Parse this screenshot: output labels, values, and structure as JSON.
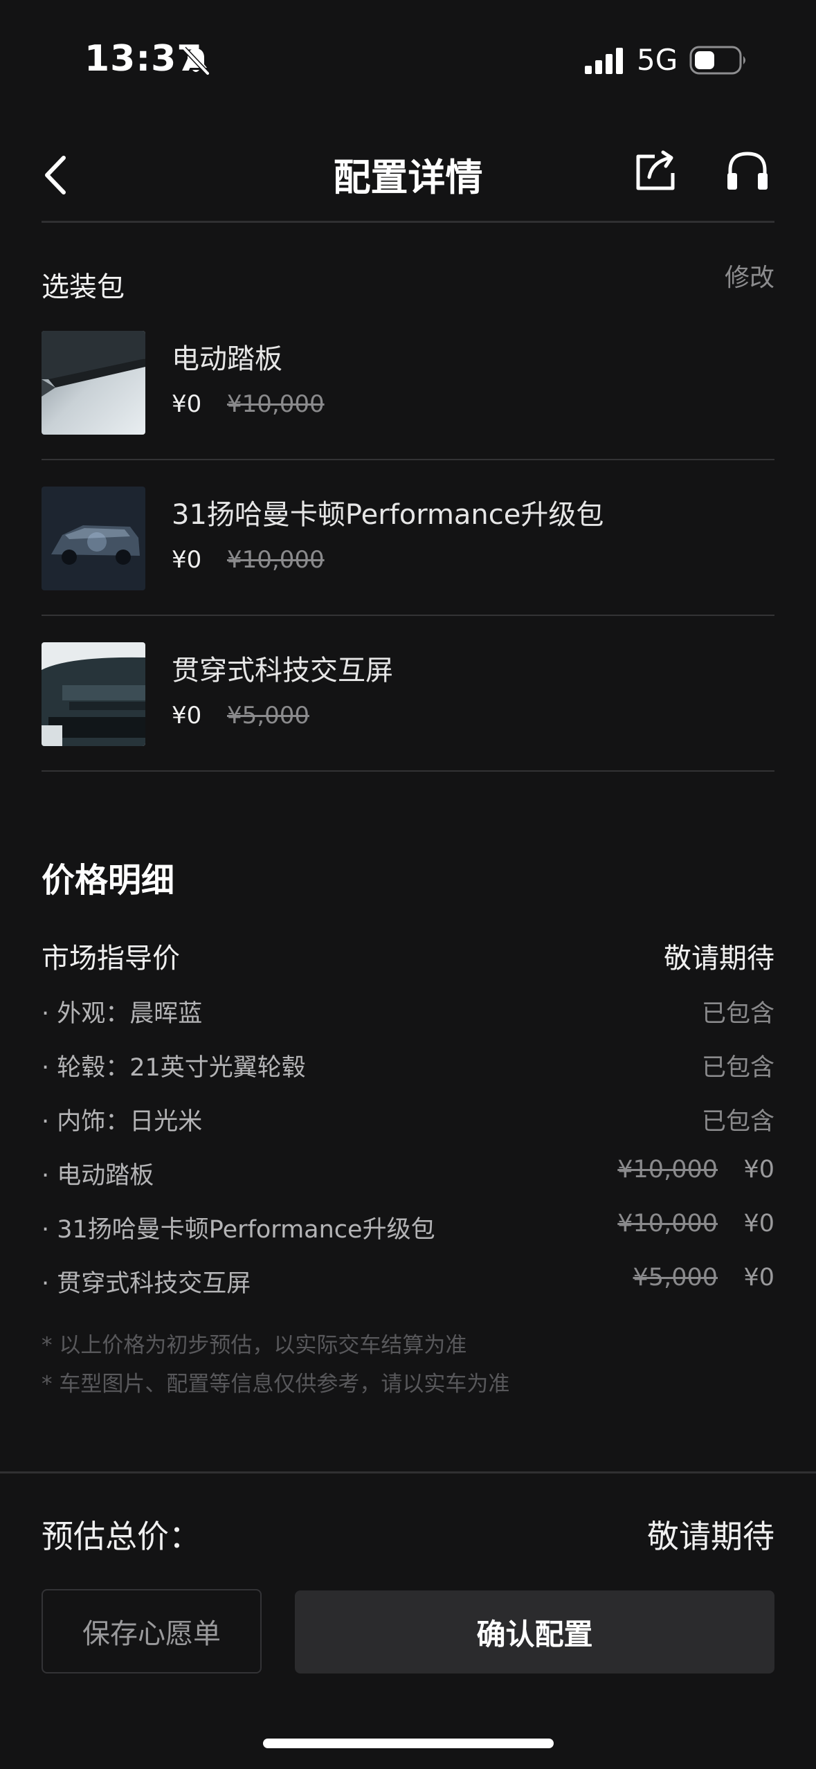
{
  "status_bar": {
    "time": "13:37",
    "network": "5G"
  },
  "nav": {
    "title": "配置详情"
  },
  "options_section": {
    "title": "选装包",
    "edit_label": "修改",
    "items": [
      {
        "name": "电动踏板",
        "price": "¥0",
        "original_price": "¥10,000"
      },
      {
        "name": "31扬哈曼卡顿Performance升级包",
        "price": "¥0",
        "original_price": "¥10,000"
      },
      {
        "name": "贯穿式科技交互屏",
        "price": "¥0",
        "original_price": "¥5,000"
      }
    ]
  },
  "price_details": {
    "title": "价格明细",
    "msrp_label": "市场指导价",
    "msrp_value": "敬请期待",
    "rows": [
      {
        "label": "· 外观：晨晖蓝",
        "value": "已包含"
      },
      {
        "label": "· 轮毂：21英寸光翼轮毂",
        "value": "已包含"
      },
      {
        "label": "· 内饰：日光米",
        "value": "已包含"
      },
      {
        "label": "· 电动踏板",
        "original_price": "¥10,000",
        "price": "¥0"
      },
      {
        "label": "· 31扬哈曼卡顿Performance升级包",
        "original_price": "¥10,000",
        "price": "¥0"
      },
      {
        "label": "· 贯穿式科技交互屏",
        "original_price": "¥5,000",
        "price": "¥0"
      }
    ],
    "notes": [
      "* 以上价格为初步预估，以实际交车结算为准",
      "* 车型图片、配置等信息仅供参考，请以实车为准"
    ]
  },
  "footer": {
    "total_label": "预估总价：",
    "total_value": "敬请期待",
    "wishlist_label": "保存心愿单",
    "confirm_label": "确认配置"
  }
}
